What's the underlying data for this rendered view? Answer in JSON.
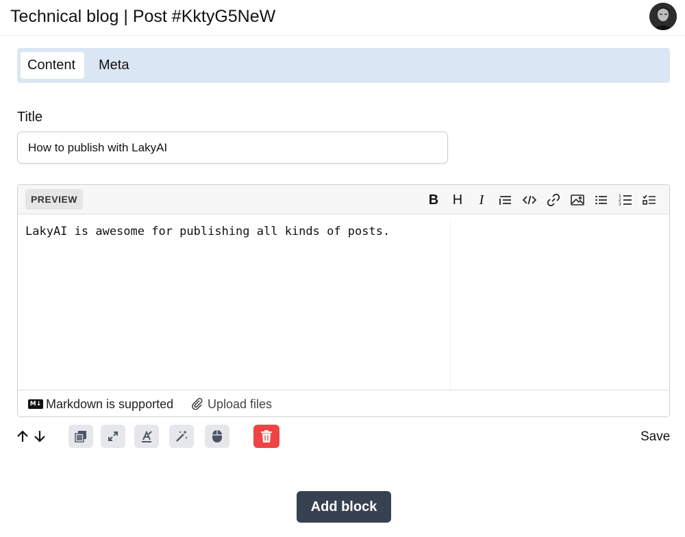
{
  "header": {
    "title": "Technical blog | Post #KktyG5NeW"
  },
  "tabs": [
    {
      "label": "Content",
      "active": true
    },
    {
      "label": "Meta",
      "active": false
    }
  ],
  "form": {
    "title_label": "Title",
    "title_value": "How to publish with LakyAI"
  },
  "editor": {
    "preview_label": "PREVIEW",
    "toolbar_icons": [
      "bold-icon",
      "heading-icon",
      "italic-icon",
      "quote-icon",
      "code-icon",
      "link-icon",
      "image-icon",
      "bullet-list-icon",
      "numbered-list-icon",
      "task-list-icon"
    ],
    "bold_glyph": "B",
    "heading_glyph": "H",
    "italic_glyph": "I",
    "content": "LakyAI is awesome for publishing all kinds of posts.",
    "markdown_badge": "M↓",
    "markdown_label": "Markdown is supported",
    "upload_label": "Upload files"
  },
  "block_actions": {
    "icons": [
      "move-up-icon",
      "move-down-icon",
      "copy-icon",
      "expand-icon",
      "format-icon",
      "magic-wand-icon",
      "mouse-icon",
      "trash-icon"
    ],
    "save_label": "Save"
  },
  "add_block_label": "Add block",
  "colors": {
    "tabbar_bg": "#dbe6f4",
    "delete_red": "#ef4444",
    "primary_button": "#374151",
    "action_button_bg": "#e5e7eb"
  }
}
